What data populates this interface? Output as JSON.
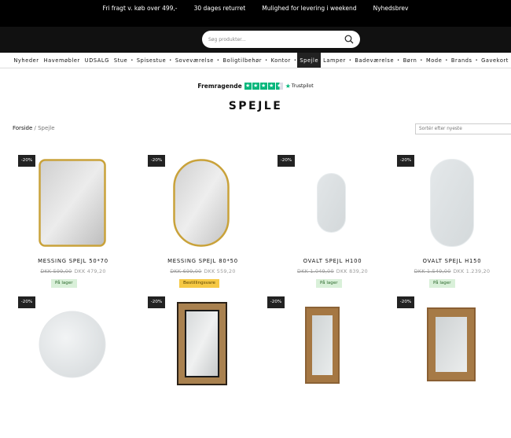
{
  "topbar": {
    "items": [
      "Fri fragt v. køb over 499,-",
      "30 dages returret",
      "Mulighed for levering i weekend",
      "Nyhedsbrev"
    ]
  },
  "search": {
    "placeholder": "Søg produkter..."
  },
  "nav": {
    "items": [
      "Nyheder",
      "Havemøbler",
      "UDSALG",
      "Stue",
      "Spisestue",
      "Soveværelse",
      "Boligtilbehør",
      "Kontor",
      "Spejle",
      "Lamper",
      "Badeværelse",
      "Børn",
      "Mode",
      "Brands",
      "Gavekort"
    ],
    "active": "Spejle"
  },
  "trust": {
    "label": "Fremragende",
    "brand": "Trustpilot",
    "stars": 4.5,
    "color": "#00b67a"
  },
  "page": {
    "title": "SPEJLE"
  },
  "breadcrumb": {
    "home": "Forside",
    "separator": "/",
    "current": "Spejle"
  },
  "sort": {
    "label": "Sortér efter nyeste"
  },
  "products": [
    {
      "badge": "-20%",
      "name": "MESSING SPEJL 50*70",
      "old_price": "DKK 599,00",
      "price": "DKK 479,20",
      "stock": "På lager",
      "stock_type": "green",
      "shape": "rect-gold"
    },
    {
      "badge": "-20%",
      "name": "MESSING SPEJL 80*50",
      "old_price": "DKK 699,00",
      "price": "DKK 559,20",
      "stock": "Bestillingsvare",
      "stock_type": "yellow",
      "shape": "oval-gold"
    },
    {
      "badge": "-20%",
      "name": "OVALT SPEJL H100",
      "old_price": "DKK 1.049,00",
      "price": "DKK 839,20",
      "stock": "På lager",
      "stock_type": "green",
      "shape": "oval-small"
    },
    {
      "badge": "-20%",
      "name": "OVALT SPEJL H150",
      "old_price": "DKK 1.549,00",
      "price": "DKK 1.239,20",
      "stock": "På lager",
      "stock_type": "green",
      "shape": "oval-tall"
    },
    {
      "badge": "-20%",
      "shape": "round"
    },
    {
      "badge": "-20%",
      "shape": "rect-wood-dark"
    },
    {
      "badge": "-20%",
      "shape": "rect-wood"
    },
    {
      "badge": "-20%",
      "shape": "rect-wood-wide"
    }
  ]
}
